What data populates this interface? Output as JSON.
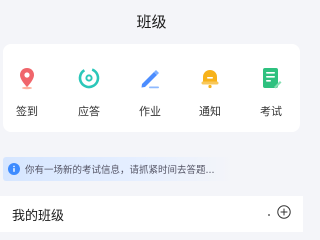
{
  "header": {
    "title": "班级"
  },
  "tools": [
    {
      "label": "签到",
      "icon": "location-pin-icon",
      "color": "#f0656b"
    },
    {
      "label": "应答",
      "icon": "response-icon",
      "color": "#2bc7b9"
    },
    {
      "label": "作业",
      "icon": "pencil-icon",
      "color": "#4c8dff"
    },
    {
      "label": "通知",
      "icon": "notification-icon",
      "color": "#f7b21a"
    },
    {
      "label": "考试",
      "icon": "exam-icon",
      "color": "#2ec17f"
    }
  ],
  "notice": {
    "text": "你有一场新的考试信息，请抓紧时间去答题...",
    "icon": "info-icon",
    "color": "#3d8bff"
  },
  "my_class": {
    "title": "我的班级",
    "add_icon": "add-circle-icon"
  }
}
